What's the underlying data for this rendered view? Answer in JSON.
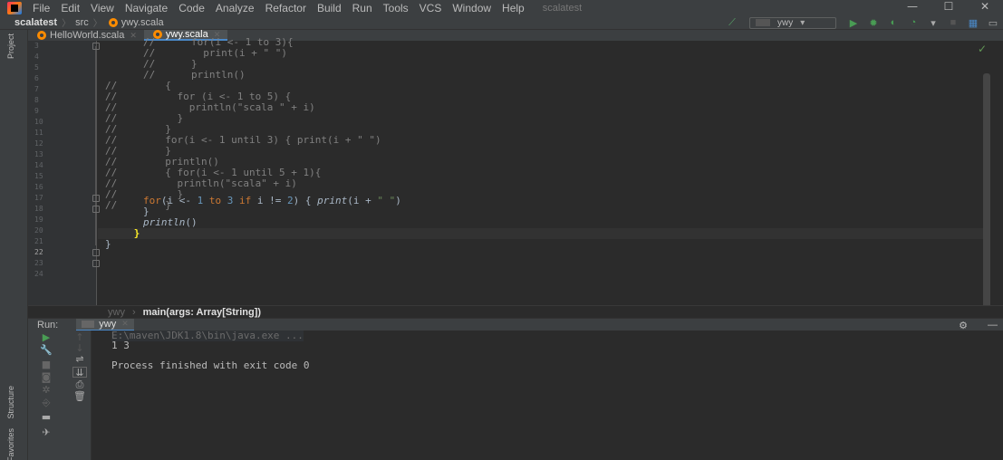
{
  "menubar": {
    "items": [
      "File",
      "Edit",
      "View",
      "Navigate",
      "Code",
      "Analyze",
      "Refactor",
      "Build",
      "Run",
      "Tools",
      "VCS",
      "Window",
      "Help"
    ],
    "project_title": "scalatest"
  },
  "navbar": {
    "crumbs": [
      "scalatest",
      "src",
      "ywy.scala"
    ],
    "run_config": "ywy"
  },
  "side_tabs": {
    "project": "Project",
    "structure": "Structure",
    "favorites": "Favorites"
  },
  "tabs": [
    {
      "label": "HelloWorld.scala",
      "active": false
    },
    {
      "label": "ywy.scala",
      "active": true
    }
  ],
  "editor": {
    "current_line": 22,
    "lines": [
      {
        "n": "3",
        "text": ""
      },
      {
        "n": "4",
        "text": ""
      },
      {
        "n": "5",
        "text": ""
      },
      {
        "n": "6",
        "text": ""
      },
      {
        "n": "7",
        "text": ""
      },
      {
        "n": "8",
        "text": ""
      },
      {
        "n": "9",
        "text": ""
      },
      {
        "n": "10",
        "text": ""
      },
      {
        "n": "11",
        "text": ""
      },
      {
        "n": "12",
        "text": ""
      },
      {
        "n": "13",
        "text": ""
      },
      {
        "n": "14",
        "text": ""
      },
      {
        "n": "15",
        "text": ""
      },
      {
        "n": "16",
        "text": ""
      },
      {
        "n": "17",
        "text": ""
      },
      {
        "n": "18",
        "text": ""
      },
      {
        "n": "19",
        "text": ""
      },
      {
        "n": "20",
        "text": ""
      },
      {
        "n": "21",
        "text": ""
      },
      {
        "n": "22",
        "text": ""
      },
      {
        "n": "23",
        "text": ""
      },
      {
        "n": "24",
        "text": ""
      }
    ]
  },
  "editor_breadcrumb": {
    "object": "ywy",
    "method": "main(args: Array[String])"
  },
  "run": {
    "label": "Run:",
    "tab": "ywy",
    "console": [
      "E:\\maven\\JDK1.8\\bin\\java.exe ...",
      "1 3",
      "",
      "Process finished with exit code 0"
    ]
  },
  "colors": {
    "background": "#2b2b2b",
    "chrome": "#3c3f41",
    "keyword": "#cc7832",
    "number": "#6897bb",
    "string": "#6a8759",
    "comment": "#808080",
    "accent": "#4a88c7"
  }
}
